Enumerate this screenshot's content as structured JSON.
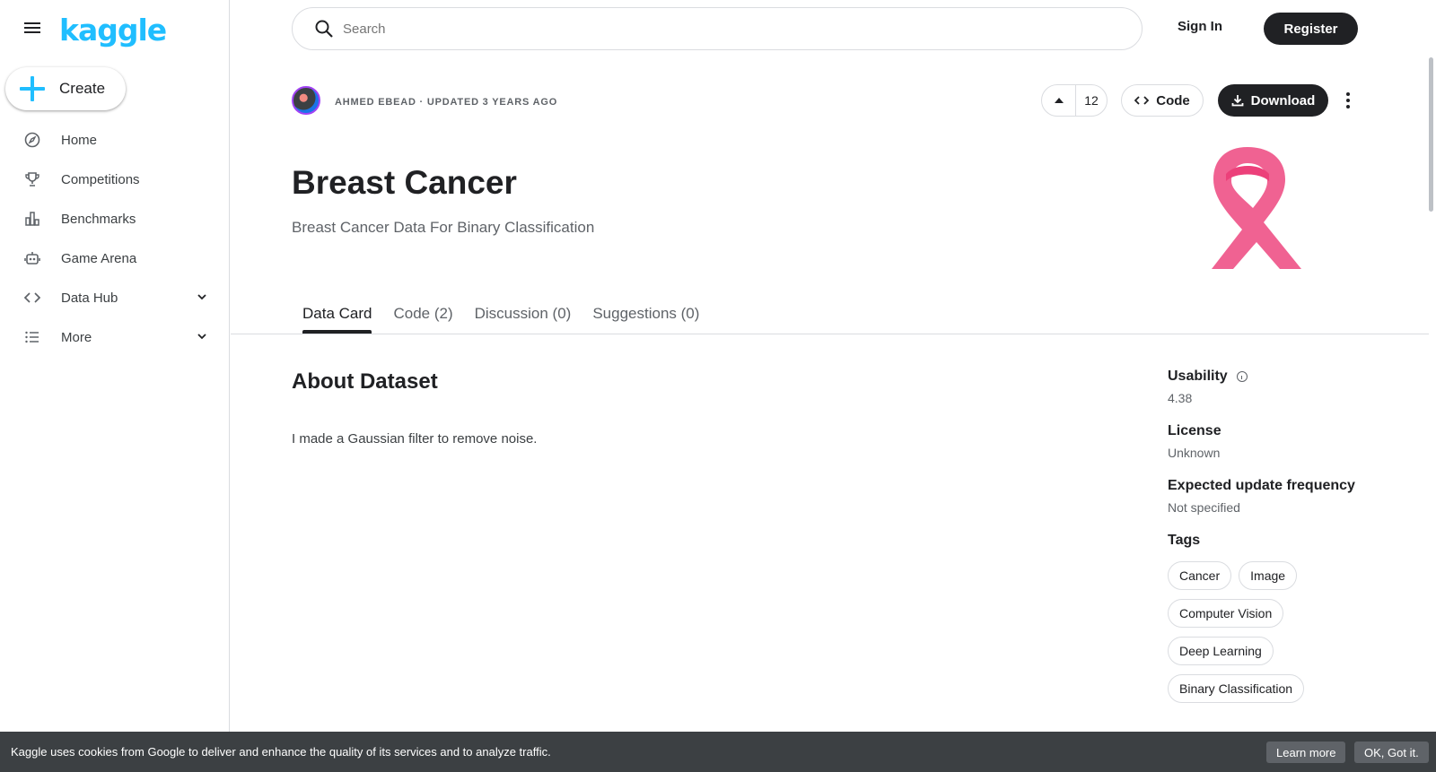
{
  "brand": {
    "logo_text": "kaggle",
    "accent_color": "#20beff"
  },
  "sidebar": {
    "create_label": "Create",
    "items": [
      {
        "label": "Home",
        "icon": "compass-icon"
      },
      {
        "label": "Competitions",
        "icon": "trophy-icon"
      },
      {
        "label": "Benchmarks",
        "icon": "bar-chart-icon"
      },
      {
        "label": "Game Arena",
        "icon": "robot-icon"
      },
      {
        "label": "Data Hub",
        "icon": "code-brackets-icon",
        "expandable": true
      },
      {
        "label": "More",
        "icon": "list-icon",
        "expandable": true
      }
    ]
  },
  "topbar": {
    "search_placeholder": "Search",
    "sign_in": "Sign In",
    "register": "Register"
  },
  "dataset": {
    "byline": "AHMED EBEAD · UPDATED 3 YEARS AGO",
    "vote_count": "12",
    "code_label": "Code",
    "download_label": "Download",
    "title": "Breast Cancer",
    "subtitle": "Breast Cancer Data For Binary Classification",
    "ribbon_color": "#f06292"
  },
  "tabs": [
    {
      "label": "Data Card",
      "active": true
    },
    {
      "label": "Code (2)",
      "active": false
    },
    {
      "label": "Discussion (0)",
      "active": false
    },
    {
      "label": "Suggestions (0)",
      "active": false
    }
  ],
  "about": {
    "heading": "About Dataset",
    "text": "I made a Gaussian filter to remove noise."
  },
  "meta": {
    "usability_label": "Usability",
    "usability_value": "4.38",
    "license_label": "License",
    "license_value": "Unknown",
    "frequency_label": "Expected update frequency",
    "frequency_value": "Not specified",
    "tags_label": "Tags",
    "tags": [
      "Cancer",
      "Image",
      "Computer Vision",
      "Deep Learning",
      "Binary Classification"
    ]
  },
  "cookie": {
    "text": "Kaggle uses cookies from Google to deliver and enhance the quality of its services and to analyze traffic.",
    "learn_more": "Learn more",
    "ok": "OK, Got it."
  }
}
